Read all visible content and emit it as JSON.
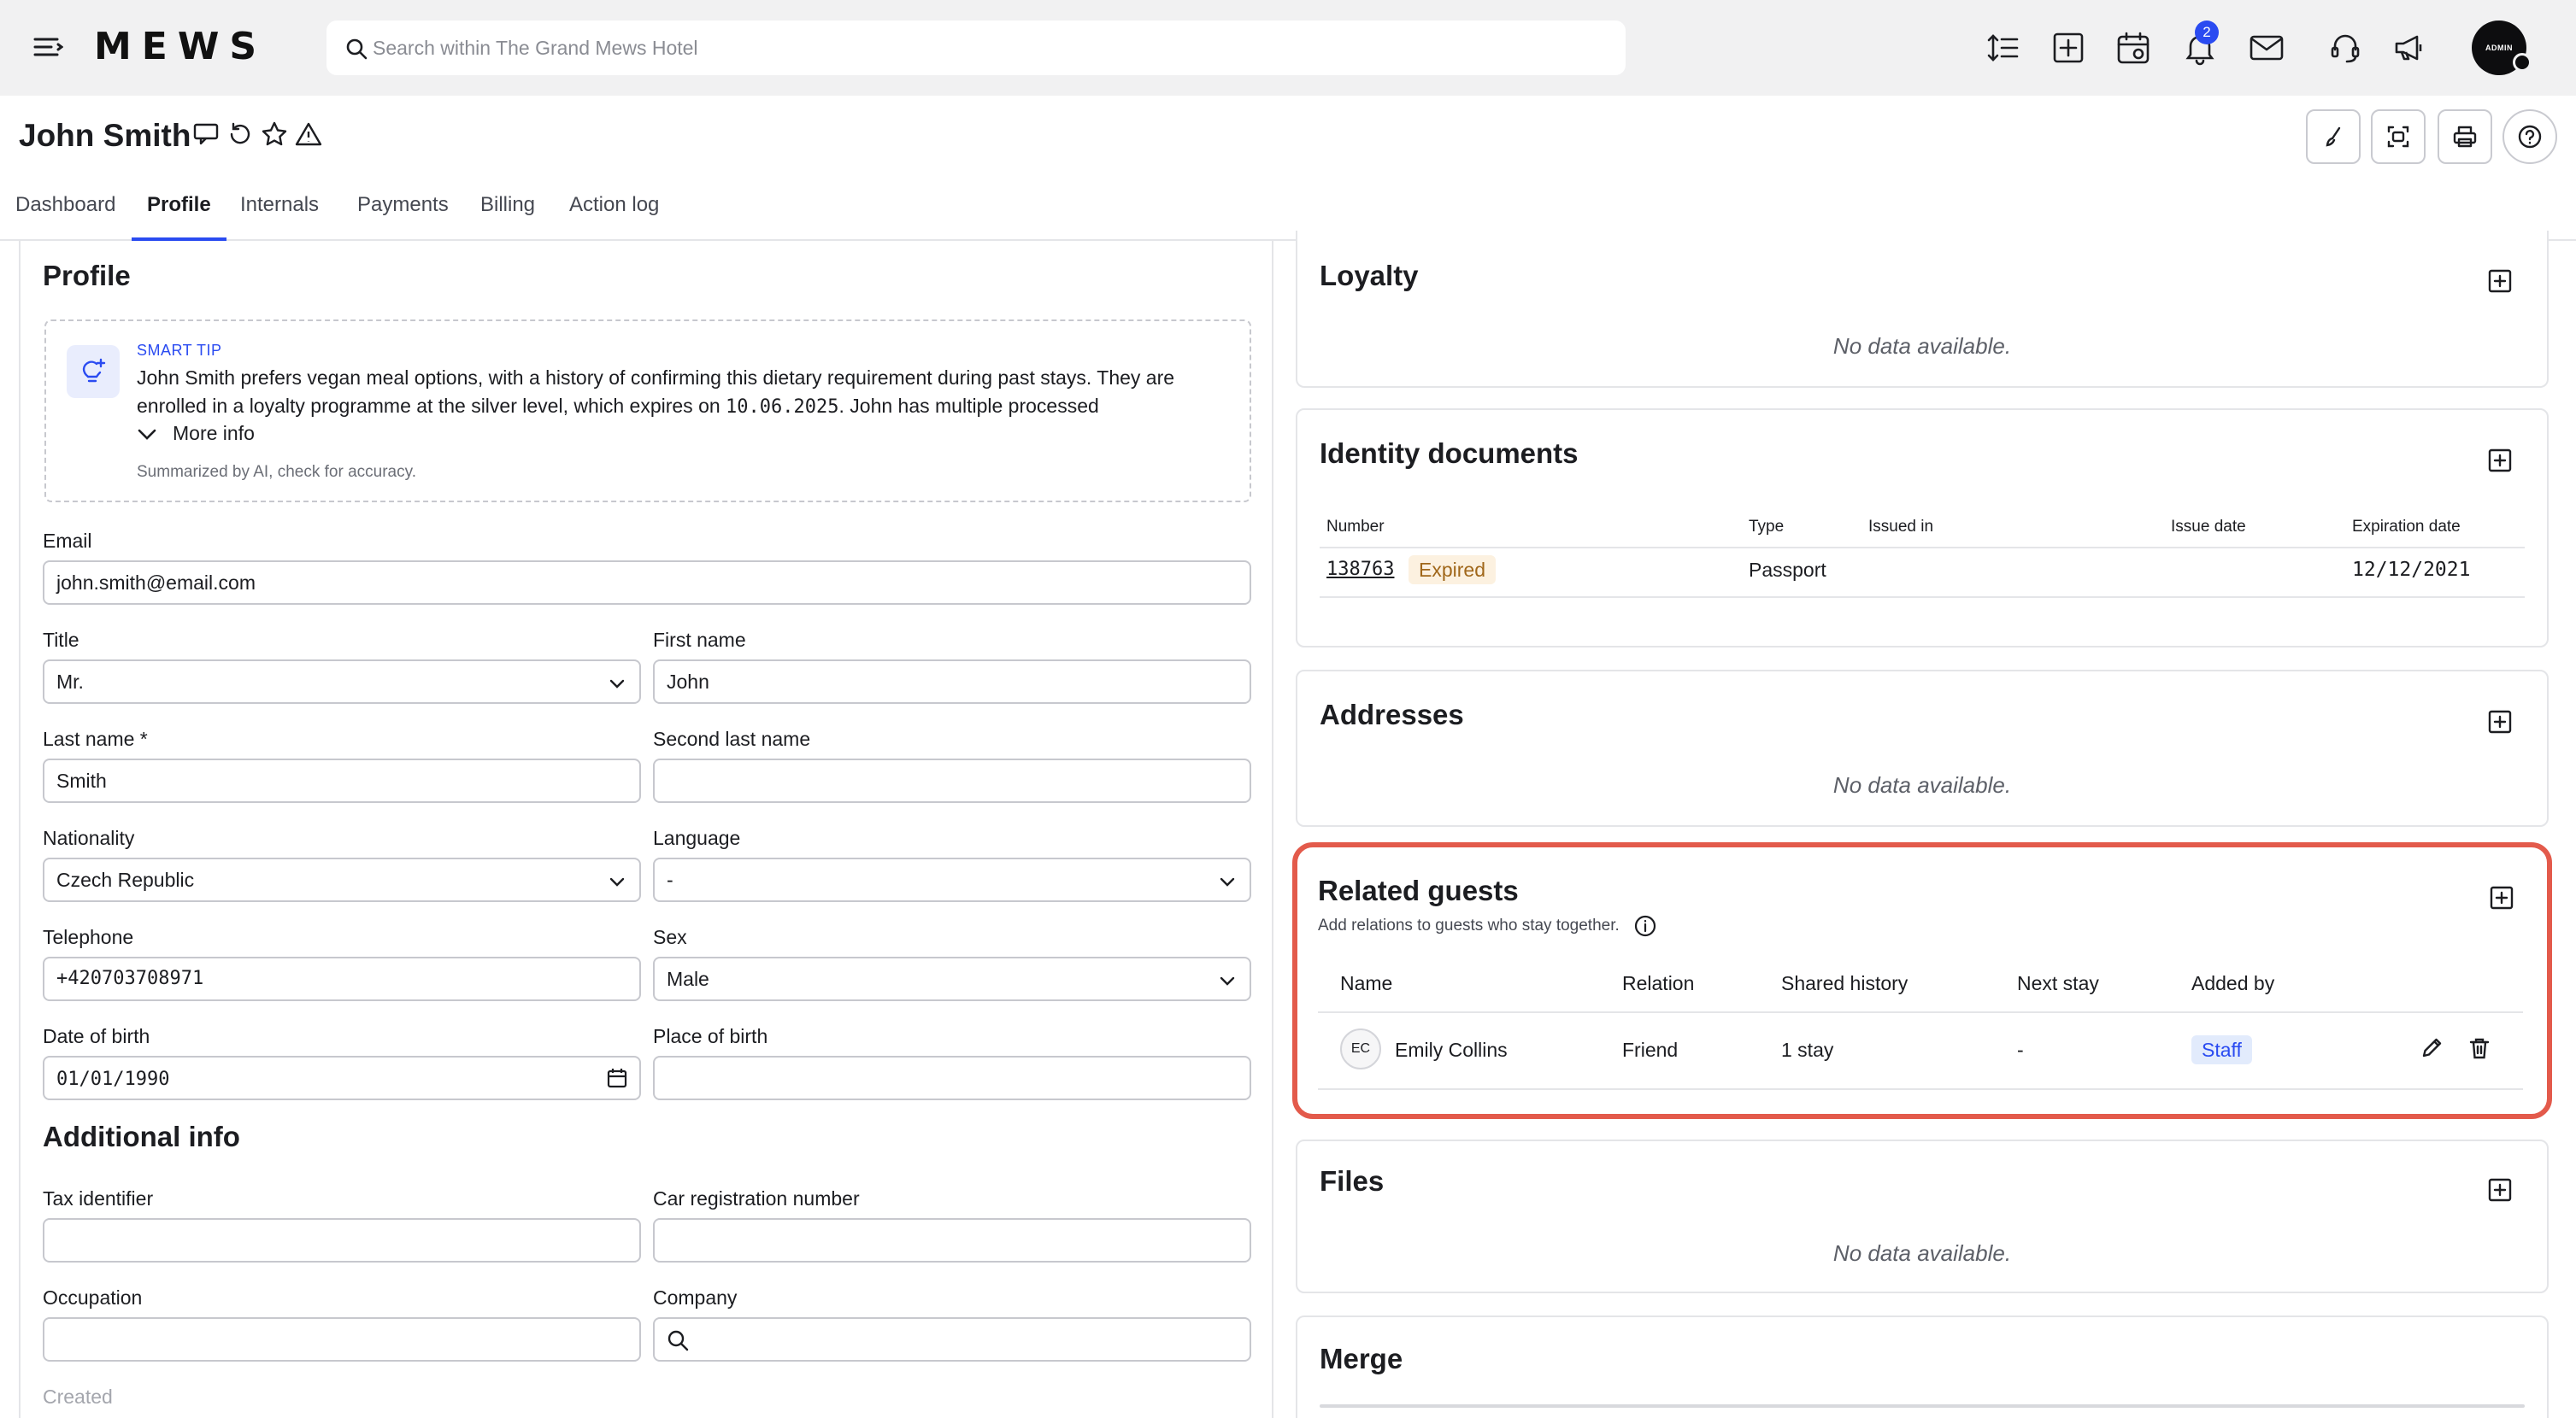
{
  "app": {
    "logo": "MEWS"
  },
  "search": {
    "placeholder": "Search within The Grand Mews Hotel"
  },
  "notifications": {
    "count": "2"
  },
  "user": {
    "avatar_label": "ADMIN"
  },
  "guest": {
    "name": "John Smith"
  },
  "tabs": [
    {
      "label": "Dashboard"
    },
    {
      "label": "Profile"
    },
    {
      "label": "Internals"
    },
    {
      "label": "Payments"
    },
    {
      "label": "Billing"
    },
    {
      "label": "Action log"
    }
  ],
  "profile": {
    "heading": "Profile",
    "smart_tip": {
      "label": "SMART TIP",
      "text_before": "John Smith prefers vegan meal options, with a history of confirming this dietary requirement during past stays. They are enrolled in a loyalty programme at the silver level, which expires on ",
      "date": "10.06.2025",
      "text_after": ". John has multiple processed",
      "more_info": "More info",
      "footer": "Summarized by AI, check for accuracy."
    },
    "fields": {
      "email": {
        "label": "Email",
        "value": "john.smith@email.com"
      },
      "title": {
        "label": "Title",
        "value": "Mr."
      },
      "first_name": {
        "label": "First name",
        "value": "John"
      },
      "last_name": {
        "label": "Last name *",
        "value": "Smith"
      },
      "second_last_name": {
        "label": "Second last name",
        "value": ""
      },
      "nationality": {
        "label": "Nationality",
        "value": "Czech Republic"
      },
      "language": {
        "label": "Language",
        "value": "-"
      },
      "telephone": {
        "label": "Telephone",
        "value": "+420703708971"
      },
      "sex": {
        "label": "Sex",
        "value": "Male"
      },
      "date_of_birth": {
        "label": "Date of birth",
        "value": "01/01/1990"
      },
      "place_of_birth": {
        "label": "Place of birth",
        "value": ""
      }
    }
  },
  "additional": {
    "heading": "Additional info",
    "fields": {
      "tax_identifier": {
        "label": "Tax identifier",
        "value": ""
      },
      "car_registration": {
        "label": "Car registration number",
        "value": ""
      },
      "occupation": {
        "label": "Occupation",
        "value": ""
      },
      "company": {
        "label": "Company",
        "value": ""
      }
    },
    "created_label": "Created"
  },
  "loyalty": {
    "title": "Loyalty",
    "empty": "No data available."
  },
  "identity": {
    "title": "Identity documents",
    "columns": [
      "Number",
      "Type",
      "Issued in",
      "Issue date",
      "Expiration date"
    ],
    "rows": [
      {
        "number": "138763",
        "status": "Expired",
        "type": "Passport",
        "issued_in": "",
        "issue_date": "",
        "expiration": "12/12/2021"
      }
    ]
  },
  "addresses": {
    "title": "Addresses",
    "empty": "No data available."
  },
  "related": {
    "title": "Related guests",
    "subtitle": "Add relations to guests who stay together.",
    "columns": [
      "Name",
      "Relation",
      "Shared history",
      "Next stay",
      "Added by"
    ],
    "rows": [
      {
        "initials": "EC",
        "name": "Emily Collins",
        "relation": "Friend",
        "shared_history": "1 stay",
        "next_stay": "-",
        "added_by": "Staff"
      }
    ]
  },
  "files": {
    "title": "Files",
    "empty": "No data available."
  },
  "merge": {
    "title": "Merge"
  },
  "colors": {
    "accent": "#2a4bf1",
    "highlight": "#e35a4b",
    "expired_bg": "#fcf1e0",
    "staff_bg": "#e2ebfc"
  }
}
